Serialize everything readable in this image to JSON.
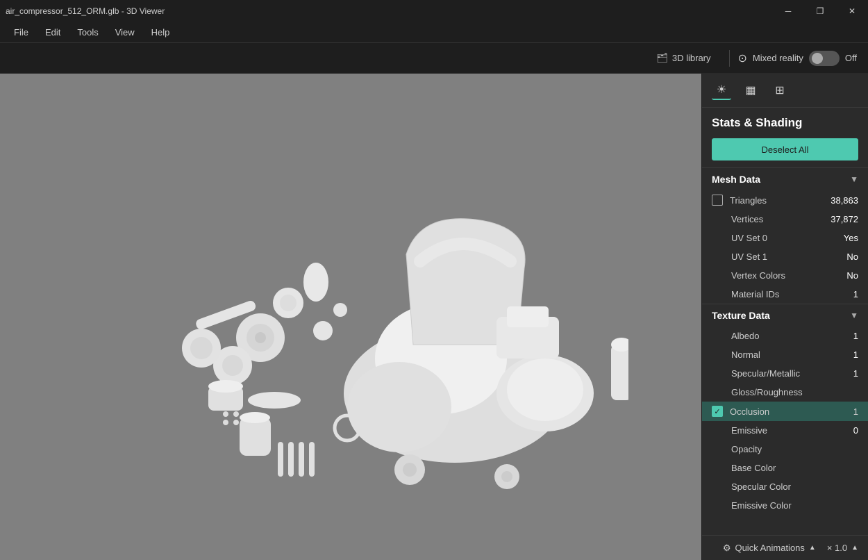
{
  "titleBar": {
    "title": "air_compressor_512_ORM.glb - 3D Viewer",
    "minimizeLabel": "─",
    "restoreLabel": "❐",
    "closeLabel": "✕"
  },
  "menuBar": {
    "items": [
      "File",
      "Edit",
      "Tools",
      "View",
      "Help"
    ]
  },
  "topBar": {
    "libraryIcon": "🗂",
    "libraryLabel": "3D library",
    "mixedRealityIcon": "⊙",
    "mixedRealityLabel": "Mixed reality",
    "offLabel": "Off"
  },
  "panelIcons": [
    {
      "name": "sun-icon",
      "symbol": "☀"
    },
    {
      "name": "grid-icon",
      "symbol": "▦"
    },
    {
      "name": "apps-icon",
      "symbol": "⊞"
    }
  ],
  "panel": {
    "title": "Stats & Shading",
    "deselectAllLabel": "Deselect All",
    "meshData": {
      "sectionTitle": "Mesh Data",
      "rows": [
        {
          "label": "Triangles",
          "value": "38,863",
          "hasCheckbox": true,
          "checked": false
        },
        {
          "label": "Vertices",
          "value": "37,872",
          "hasCheckbox": false
        },
        {
          "label": "UV Set 0",
          "value": "Yes",
          "hasCheckbox": false
        },
        {
          "label": "UV Set 1",
          "value": "No",
          "hasCheckbox": false
        },
        {
          "label": "Vertex Colors",
          "value": "No",
          "hasCheckbox": false
        },
        {
          "label": "Material IDs",
          "value": "1",
          "hasCheckbox": false
        }
      ]
    },
    "textureData": {
      "sectionTitle": "Texture Data",
      "rows": [
        {
          "label": "Albedo",
          "value": "1",
          "hasCheckbox": false,
          "checked": false
        },
        {
          "label": "Normal",
          "value": "1",
          "hasCheckbox": false,
          "checked": false
        },
        {
          "label": "Specular/Metallic",
          "value": "1",
          "hasCheckbox": false,
          "checked": false
        },
        {
          "label": "Gloss/Roughness",
          "value": "",
          "hasCheckbox": false,
          "checked": false
        },
        {
          "label": "Occlusion",
          "value": "1",
          "hasCheckbox": false,
          "checked": true
        },
        {
          "label": "Emissive",
          "value": "0",
          "hasCheckbox": false,
          "checked": false
        },
        {
          "label": "Opacity",
          "value": "",
          "hasCheckbox": false,
          "checked": false
        },
        {
          "label": "Base Color",
          "value": "",
          "hasCheckbox": false,
          "checked": false
        },
        {
          "label": "Specular Color",
          "value": "",
          "hasCheckbox": false,
          "checked": false
        },
        {
          "label": "Emissive Color",
          "value": "",
          "hasCheckbox": false,
          "checked": false
        }
      ]
    }
  },
  "bottomBar": {
    "quickAnimIcon": "⚙",
    "quickAnimLabel": "Quick Animations",
    "scaleLabel": "× 1.0"
  }
}
